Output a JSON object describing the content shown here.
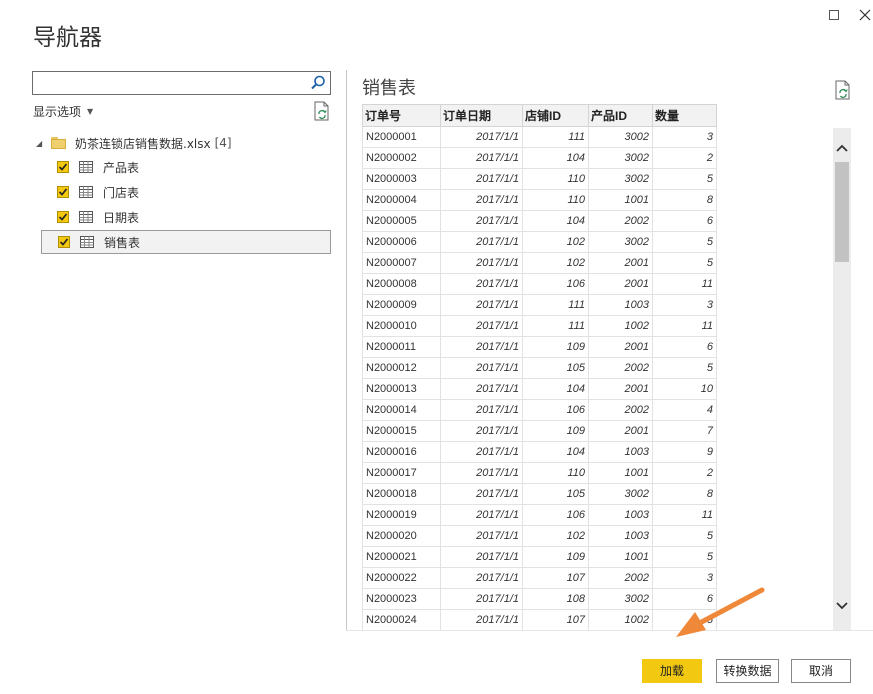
{
  "window": {
    "title": "导航器",
    "maximize_icon": "maximize-icon",
    "close_icon": "close-icon"
  },
  "left_panel": {
    "search": {
      "value": "",
      "placeholder": ""
    },
    "display_options_label": "显示选项",
    "tree": {
      "root_label": "奶茶连锁店销售数据.xlsx",
      "root_count": "[4]",
      "items": [
        {
          "label": "产品表",
          "checked": true,
          "selected": false
        },
        {
          "label": "门店表",
          "checked": true,
          "selected": false
        },
        {
          "label": "日期表",
          "checked": true,
          "selected": false
        },
        {
          "label": "销售表",
          "checked": true,
          "selected": true
        }
      ]
    }
  },
  "preview": {
    "title": "销售表",
    "columns": [
      "订单号",
      "订单日期",
      "店铺ID",
      "产品ID",
      "数量"
    ],
    "rows": [
      [
        "N2000001",
        "2017/1/1",
        "111",
        "3002",
        "3"
      ],
      [
        "N2000002",
        "2017/1/1",
        "104",
        "3002",
        "2"
      ],
      [
        "N2000003",
        "2017/1/1",
        "110",
        "3002",
        "5"
      ],
      [
        "N2000004",
        "2017/1/1",
        "110",
        "1001",
        "8"
      ],
      [
        "N2000005",
        "2017/1/1",
        "104",
        "2002",
        "6"
      ],
      [
        "N2000006",
        "2017/1/1",
        "102",
        "3002",
        "5"
      ],
      [
        "N2000007",
        "2017/1/1",
        "102",
        "2001",
        "5"
      ],
      [
        "N2000008",
        "2017/1/1",
        "106",
        "2001",
        "11"
      ],
      [
        "N2000009",
        "2017/1/1",
        "111",
        "1003",
        "3"
      ],
      [
        "N2000010",
        "2017/1/1",
        "111",
        "1002",
        "11"
      ],
      [
        "N2000011",
        "2017/1/1",
        "109",
        "2001",
        "6"
      ],
      [
        "N2000012",
        "2017/1/1",
        "105",
        "2002",
        "5"
      ],
      [
        "N2000013",
        "2017/1/1",
        "104",
        "2001",
        "10"
      ],
      [
        "N2000014",
        "2017/1/1",
        "106",
        "2002",
        "4"
      ],
      [
        "N2000015",
        "2017/1/1",
        "109",
        "2001",
        "7"
      ],
      [
        "N2000016",
        "2017/1/1",
        "104",
        "1003",
        "9"
      ],
      [
        "N2000017",
        "2017/1/1",
        "110",
        "1001",
        "2"
      ],
      [
        "N2000018",
        "2017/1/1",
        "105",
        "3002",
        "8"
      ],
      [
        "N2000019",
        "2017/1/1",
        "106",
        "1003",
        "11"
      ],
      [
        "N2000020",
        "2017/1/1",
        "102",
        "1003",
        "5"
      ],
      [
        "N2000021",
        "2017/1/1",
        "109",
        "1001",
        "5"
      ],
      [
        "N2000022",
        "2017/1/1",
        "107",
        "2002",
        "3"
      ],
      [
        "N2000023",
        "2017/1/1",
        "108",
        "3002",
        "6"
      ],
      [
        "N2000024",
        "2017/1/1",
        "107",
        "1002",
        "5"
      ]
    ]
  },
  "buttons": {
    "load": "加载",
    "transform": "转换数据",
    "cancel": "取消"
  },
  "colors": {
    "accent": "#f2c811",
    "annotation_arrow": "#f0883a"
  }
}
